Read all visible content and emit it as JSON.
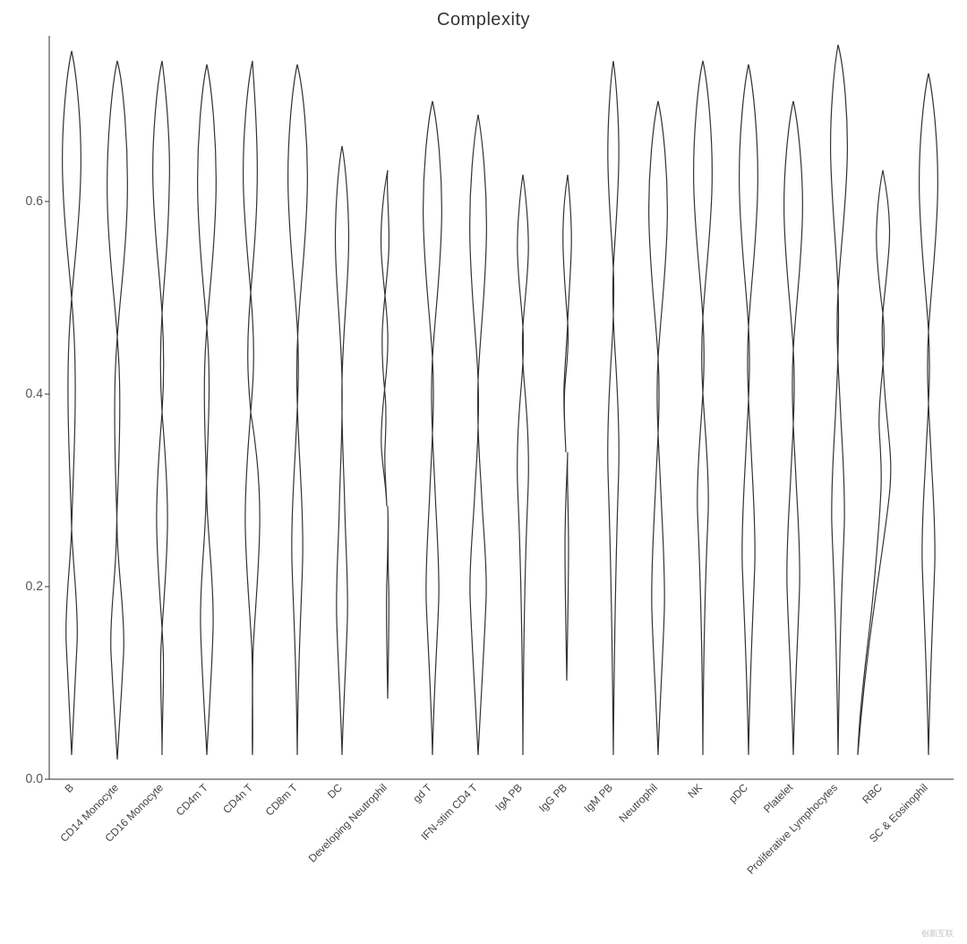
{
  "chart": {
    "title": "Complexity",
    "yAxis": {
      "min": 0.0,
      "max": 0.8,
      "ticks": [
        0.0,
        0.2,
        0.4,
        0.6
      ]
    },
    "categories": [
      "B",
      "CD14 Monocyte",
      "CD16 Monocyte",
      "CD4m T",
      "CD4n T",
      "CD8m T",
      "DC",
      "Developing Neutrophil",
      "gd T",
      "IFN-stim CD4 T",
      "IgA PB",
      "IgG PB",
      "IgM PB",
      "Neutrophil",
      "NK",
      "pDC",
      "Platelet",
      "Proliferative Lymphocytes",
      "RBC",
      "SC & Eosinophil"
    ]
  }
}
